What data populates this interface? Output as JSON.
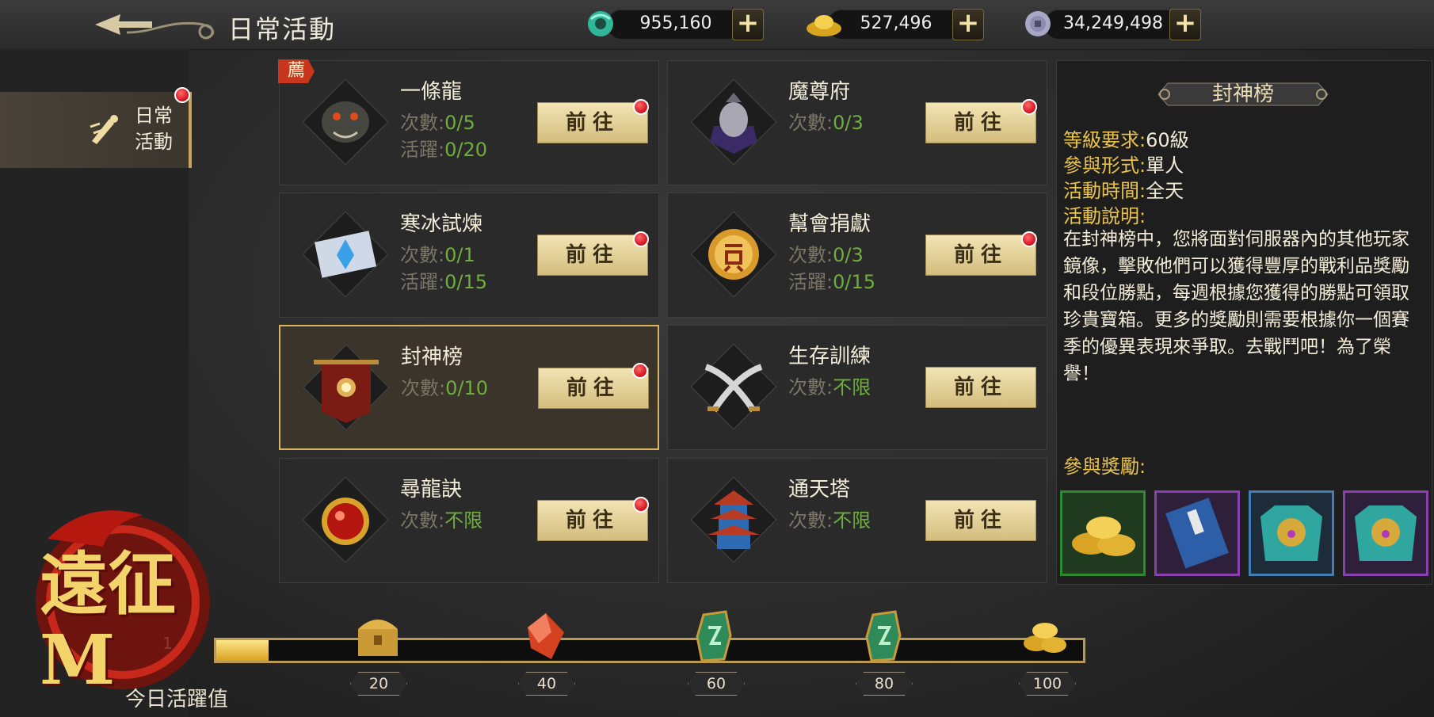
{
  "header": {
    "title": "日常活動",
    "currencies": [
      {
        "icon": "jade-icon",
        "value": "955,160"
      },
      {
        "icon": "gold-ingot-icon",
        "value": "527,496"
      },
      {
        "icon": "silver-coin-icon",
        "value": "34,249,498"
      }
    ],
    "plus_label": "+"
  },
  "sidebar": {
    "tabs": [
      {
        "label": "日常活動",
        "label_l1": "日常",
        "label_l2": "活動",
        "icon": "daily-activity-icon",
        "has_alert": true
      }
    ]
  },
  "activities": [
    {
      "title": "一條龍",
      "count_label": "次數:",
      "count": "0/5",
      "active_label": "活躍:",
      "active": "0/20",
      "badge": "薦",
      "button": "前往",
      "icon": "dragon-head-icon",
      "has_alert": true
    },
    {
      "title": "魔尊府",
      "count_label": "次數:",
      "count": "0/3",
      "button": "前往",
      "icon": "demon-lord-icon",
      "has_alert": true
    },
    {
      "title": "寒冰試煉",
      "count_label": "次數:",
      "count": "0/1",
      "active_label": "活躍:",
      "active": "0/15",
      "button": "前往",
      "icon": "ice-scroll-icon",
      "has_alert": true
    },
    {
      "title": "幫會捐獻",
      "count_label": "次數:",
      "count": "0/3",
      "active_label": "活躍:",
      "active": "0/15",
      "button": "前往",
      "icon": "guild-coin-icon",
      "has_alert": true
    },
    {
      "title": "封神榜",
      "count_label": "次數:",
      "count": "0/10",
      "button": "前往",
      "icon": "banner-icon",
      "has_alert": true,
      "selected": true
    },
    {
      "title": "生存訓練",
      "count_label": "次數:",
      "count": "不限",
      "button": "前往",
      "icon": "crossed-swords-icon",
      "has_alert": false
    },
    {
      "title": "尋龍訣",
      "count_label": "次數:",
      "count": "不限",
      "button": "前往",
      "icon": "dragon-orb-icon",
      "has_alert": true
    },
    {
      "title": "通天塔",
      "count_label": "次數:",
      "count": "不限",
      "button": "前往",
      "icon": "pagoda-icon",
      "has_alert": false
    }
  ],
  "info": {
    "title": "封神榜",
    "level_label": "等級要求:",
    "level": "60級",
    "mode_label": "參與形式:",
    "mode": "單人",
    "time_label": "活動時間:",
    "time": "全天",
    "desc_label": "活動說明:",
    "desc": "在封神榜中，您將面對伺服器內的其他玩家鏡像，擊敗他們可以獲得豐厚的戰利品獎勵和段位勝點，每週根據您獲得的勝點可領取珍貴寶箱。更多的獎勵則需要根據你一個賽季的優異表現來爭取。去戰鬥吧！為了榮譽！",
    "rewards_label": "參與獎勵:",
    "rewards": [
      {
        "icon": "gold-ingots-icon",
        "frame_color": "#2f8a2f"
      },
      {
        "icon": "blue-book-icon",
        "frame_color": "#8a3fb0"
      },
      {
        "icon": "beast-armor-icon",
        "frame_color": "#3f7fb5"
      },
      {
        "icon": "beast-armor-icon",
        "frame_color": "#8a3fb0"
      }
    ]
  },
  "progress": {
    "title": "今日活躍值",
    "value": "1",
    "fill_fraction": 0.06,
    "milestones": [
      {
        "label": "20",
        "icon": "treasure-chest-icon"
      },
      {
        "label": "40",
        "icon": "red-gem-icon"
      },
      {
        "label": "60",
        "icon": "jade-token-icon"
      },
      {
        "label": "80",
        "icon": "jade-token-icon"
      },
      {
        "label": "100",
        "icon": "gold-ingots-icon"
      }
    ]
  },
  "logo": {
    "text": "遠征M"
  },
  "colors": {
    "accent_gold": "#d8b460",
    "value_green": "#6fae3e",
    "label_yellow": "#e9c34c",
    "alert_red": "#d10f1a"
  }
}
